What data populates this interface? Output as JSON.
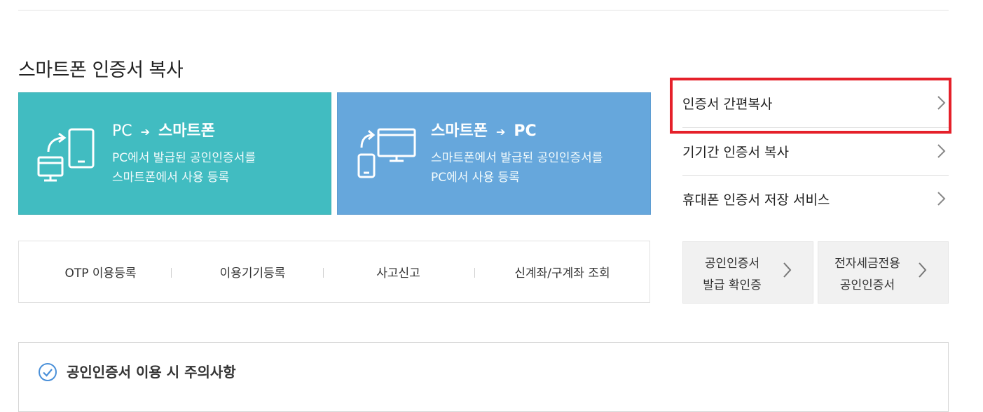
{
  "section": {
    "title": "스마트폰 인증서 복사"
  },
  "cards": [
    {
      "from": "PC",
      "to": "스마트폰",
      "desc_line1": "PC에서 발급된 공인인증서를",
      "desc_line2": "스마트폰에서 사용 등록"
    },
    {
      "from": "스마트폰",
      "to": "PC",
      "desc_line1": "스마트폰에서 발급된 공인인증서를",
      "desc_line2": "PC에서 사용 등록"
    }
  ],
  "arrow_glyph": "➔",
  "quick_links": [
    "OTP 이용등록",
    "이용기기등록",
    "사고신고",
    "신계좌/구계좌 조회"
  ],
  "side_links": [
    "인증서 간편복사",
    "기기간 인증서 복사",
    "휴대폰 인증서 저장 서비스"
  ],
  "grey_boxes": [
    {
      "line1": "공인인증서",
      "line2": "발급 확인증"
    },
    {
      "line1": "전자세금전용",
      "line2": "공인인증서"
    }
  ],
  "notice": {
    "title": "공인인증서 이용 시 주의사항"
  },
  "colors": {
    "teal": "#41bcc1",
    "blue": "#66a7dc",
    "highlight": "#e5202a",
    "check": "#4a90d9"
  },
  "icons": [
    "pc-to-phone-icon",
    "phone-to-pc-icon",
    "chevron-right-icon",
    "check-circle-icon"
  ]
}
